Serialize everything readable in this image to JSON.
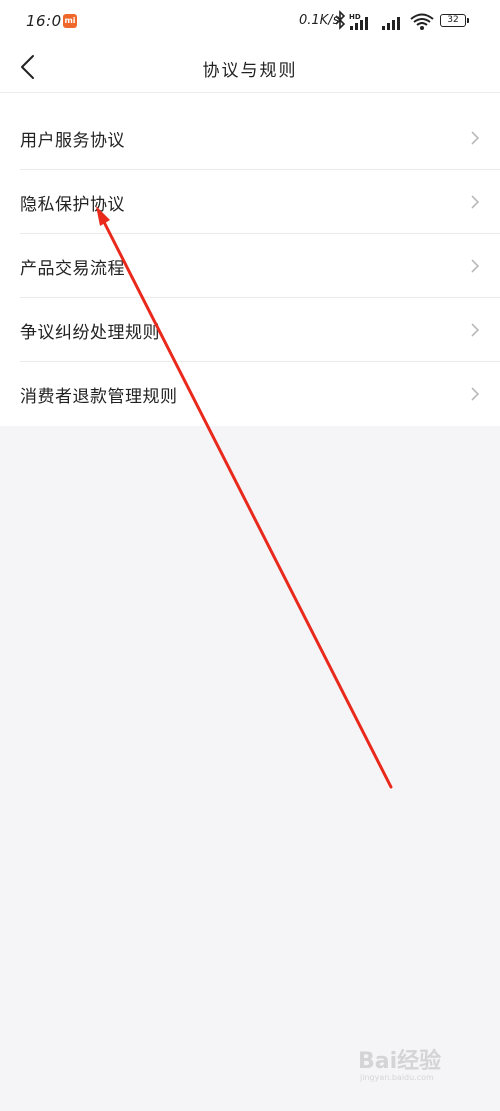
{
  "status_bar": {
    "time": "16:07",
    "net_speed": "0.1K/s",
    "battery": "32"
  },
  "header": {
    "title": "协议与规则"
  },
  "menu": {
    "items": [
      {
        "label": "用户服务协议"
      },
      {
        "label": "隐私保护协议"
      },
      {
        "label": "产品交易流程"
      },
      {
        "label": "争议纠纷处理规则"
      },
      {
        "label": "消费者退款管理规则"
      }
    ]
  },
  "watermark": {
    "text": "Bai经验",
    "sub": "jingyan.baidu.com"
  },
  "colors": {
    "background": "#f5f5f8",
    "surface": "#ffffff",
    "annotation_arrow": "#e8291c",
    "mi_badge": "#f0672a"
  }
}
